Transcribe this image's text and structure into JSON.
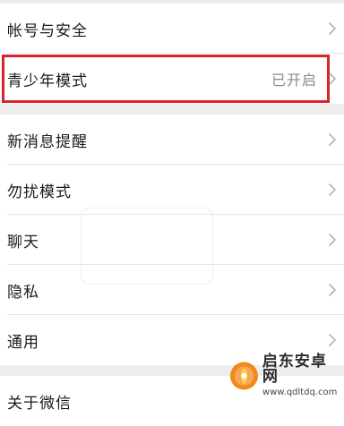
{
  "settings": {
    "group1": [
      {
        "label": "帐号与安全",
        "value": ""
      },
      {
        "label": "青少年模式",
        "value": "已开启"
      }
    ],
    "group2": [
      {
        "label": "新消息提醒",
        "value": ""
      },
      {
        "label": "勿扰模式",
        "value": ""
      },
      {
        "label": "聊天",
        "value": ""
      },
      {
        "label": "隐私",
        "value": ""
      },
      {
        "label": "通用",
        "value": ""
      }
    ],
    "group3": [
      {
        "label": "关于微信",
        "value": ""
      }
    ]
  },
  "watermark": {
    "title": "启东安卓网",
    "url": "www.qdltdq.com"
  },
  "colors": {
    "highlight": "#d9232e",
    "chevron": "#b2b2b2",
    "background": "#ededed"
  }
}
